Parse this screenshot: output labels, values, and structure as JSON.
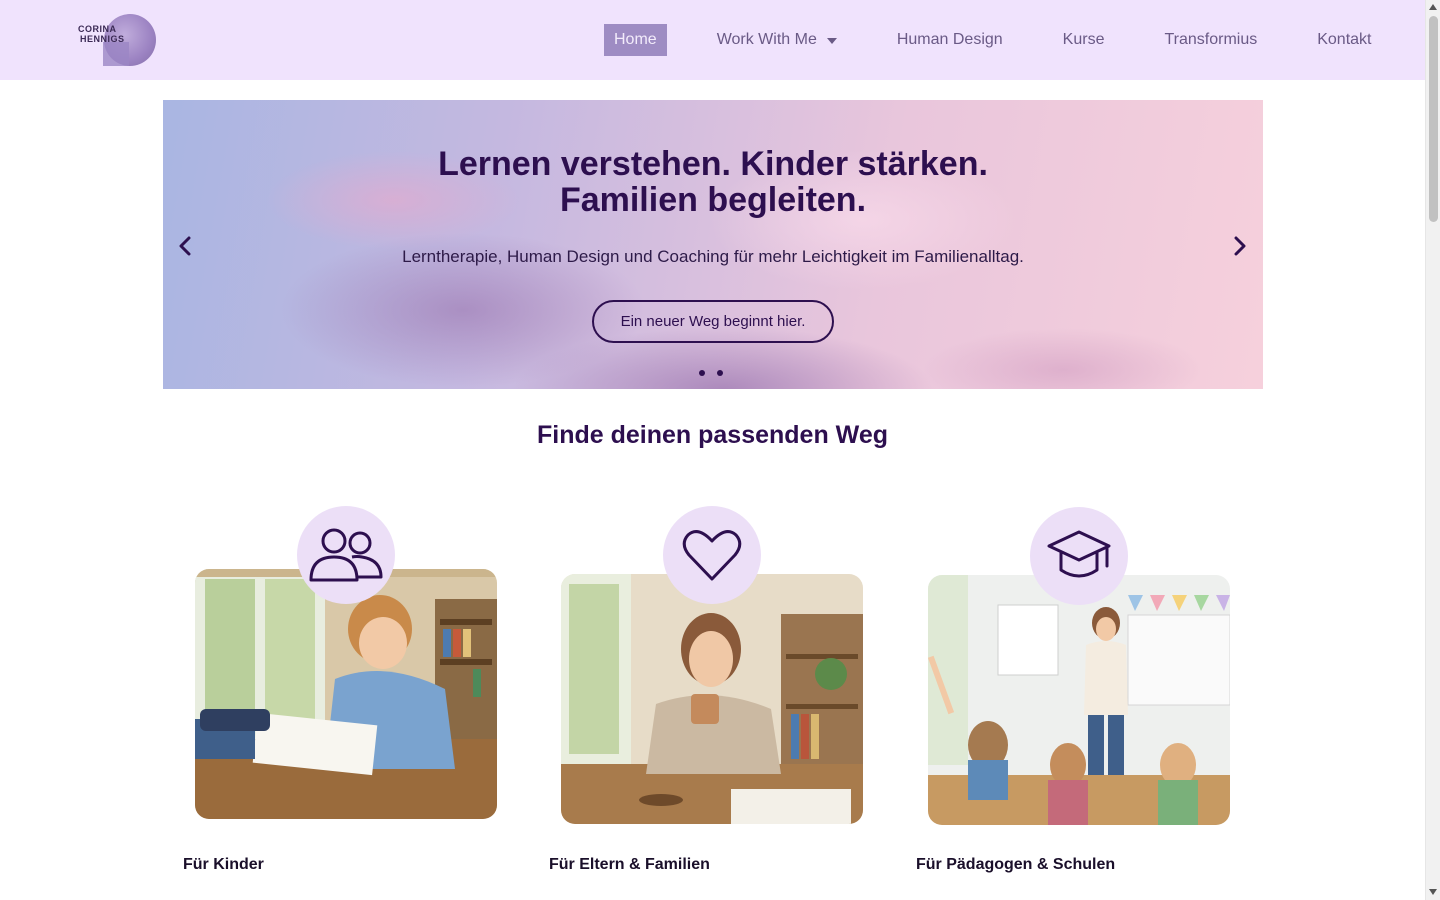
{
  "logo": {
    "line1": "CORINA",
    "line2": "HENNIGS"
  },
  "nav": {
    "items": [
      {
        "label": "Home",
        "active": true
      },
      {
        "label": "Work With Me",
        "dropdown": true
      },
      {
        "label": "Human Design"
      },
      {
        "label": "Kurse"
      },
      {
        "label": "Transformius"
      },
      {
        "label": "Kontakt"
      }
    ]
  },
  "hero": {
    "title_line1": "Lernen verstehen. Kinder stärken.",
    "title_line2": "Familien begleiten.",
    "subtitle": "Lerntherapie, Human Design und Coaching für mehr Leichtigkeit im Familienalltag.",
    "button_label": "Ein neuer Weg beginnt hier.",
    "slide_count": 2
  },
  "section": {
    "title": "Finde deinen passenden Weg",
    "cards": [
      {
        "label": "Für Kinder",
        "icon": "people-icon"
      },
      {
        "label": "Für Eltern & Familien",
        "icon": "heart-icon"
      },
      {
        "label": "Für Pädagogen & Schulen",
        "icon": "graduation-cap-icon"
      }
    ]
  },
  "colors": {
    "header_bg": "#f0e3fd",
    "accent": "#2d0f4f",
    "nav_active_bg": "#9e8cc3",
    "icon_circle": "#ecdff7"
  }
}
